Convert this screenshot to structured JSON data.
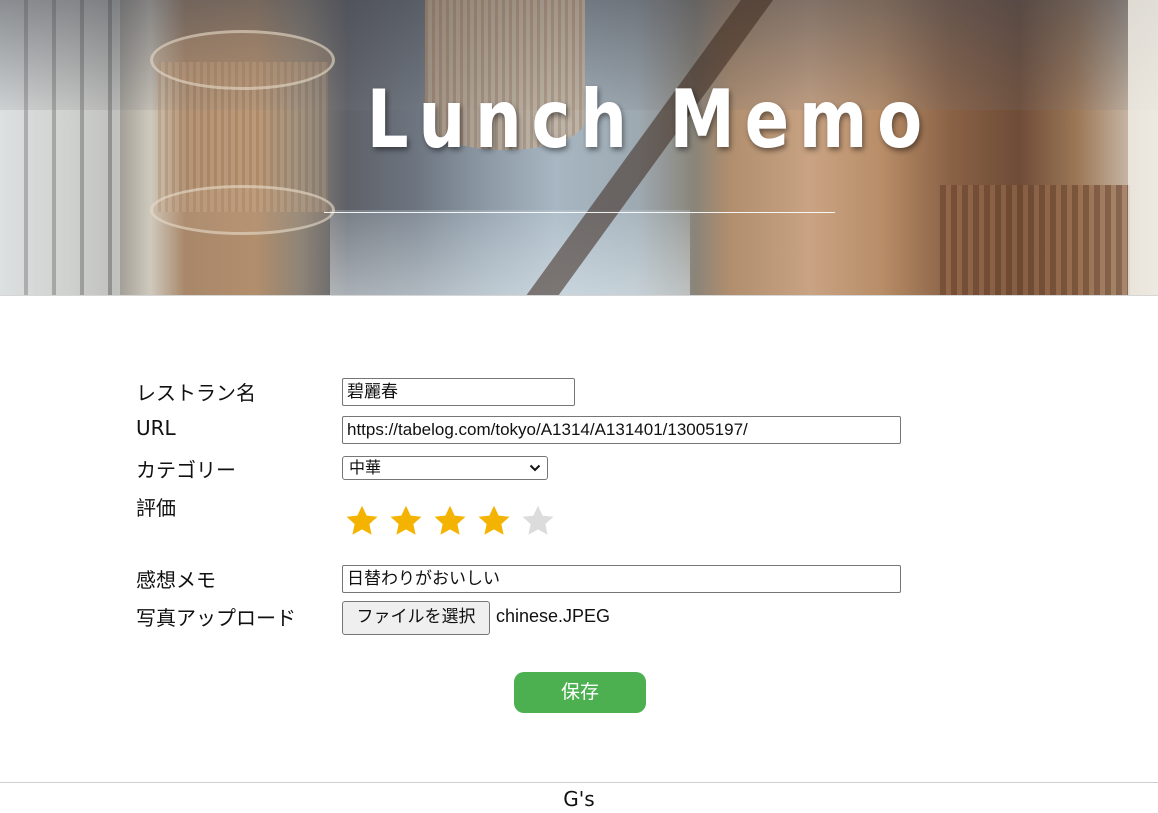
{
  "header": {
    "title": "Lunch Memo"
  },
  "form": {
    "restaurant_name": {
      "label": "レストラン名",
      "value": "碧麗春"
    },
    "url": {
      "label": "URL",
      "value": "https://tabelog.com/tokyo/A1314/A131401/13005197/"
    },
    "category": {
      "label": "カテゴリー",
      "selected": "中華"
    },
    "rating": {
      "label": "評価",
      "value": 4,
      "max": 5,
      "filled_color": "#f5b301",
      "empty_color": "#dcdcdc"
    },
    "memo": {
      "label": "感想メモ",
      "value": "日替わりがおいしい"
    },
    "photo": {
      "label": "写真アップロード",
      "button_label": "ファイルを選択",
      "file_name": "chinese.JPEG"
    },
    "save_label": "保存"
  },
  "footer": {
    "text": "G's"
  },
  "colors": {
    "accent_button": "#4caf50"
  }
}
